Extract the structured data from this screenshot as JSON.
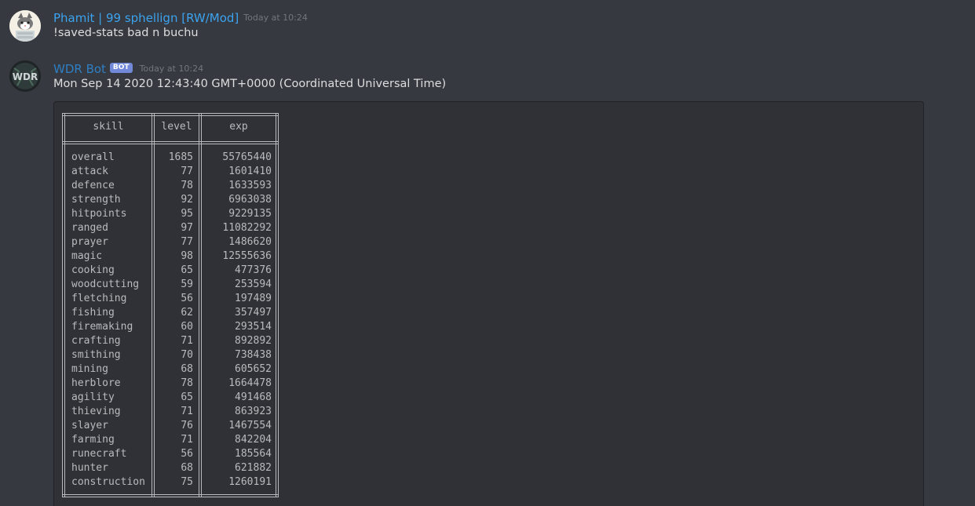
{
  "messages": [
    {
      "username": "Phamit | 99 sphellign [RW/Mod]",
      "username_color": "#3ba3f0",
      "timestamp": "Today at 10:24",
      "text": "!saved-stats bad n buchu"
    },
    {
      "username": "WDR Bot",
      "username_color": "#2e7fc4",
      "bot_tag": "BOT",
      "avatar_text": "WDR",
      "timestamp": "Today at 10:24",
      "text": "Mon Sep 14 2020 12:43:40 GMT+0000 (Coordinated Universal Time)"
    }
  ],
  "stats_table": {
    "headers": [
      "skill",
      "level",
      "exp"
    ],
    "rows": [
      [
        "overall",
        "1685",
        "55765440"
      ],
      [
        "attack",
        "77",
        "1601410"
      ],
      [
        "defence",
        "78",
        "1633593"
      ],
      [
        "strength",
        "92",
        "6963038"
      ],
      [
        "hitpoints",
        "95",
        "9229135"
      ],
      [
        "ranged",
        "97",
        "11082292"
      ],
      [
        "prayer",
        "77",
        "1486620"
      ],
      [
        "magic",
        "98",
        "12555636"
      ],
      [
        "cooking",
        "65",
        "477376"
      ],
      [
        "woodcutting",
        "59",
        "253594"
      ],
      [
        "fletching",
        "56",
        "197489"
      ],
      [
        "fishing",
        "62",
        "357497"
      ],
      [
        "firemaking",
        "60",
        "293514"
      ],
      [
        "crafting",
        "71",
        "892892"
      ],
      [
        "smithing",
        "70",
        "738438"
      ],
      [
        "mining",
        "68",
        "605652"
      ],
      [
        "herblore",
        "78",
        "1664478"
      ],
      [
        "agility",
        "65",
        "491468"
      ],
      [
        "thieving",
        "71",
        "863923"
      ],
      [
        "slayer",
        "76",
        "1467554"
      ],
      [
        "farming",
        "71",
        "842204"
      ],
      [
        "runecraft",
        "56",
        "185564"
      ],
      [
        "hunter",
        "68",
        "621882"
      ],
      [
        "construction",
        "75",
        "1260191"
      ]
    ]
  }
}
